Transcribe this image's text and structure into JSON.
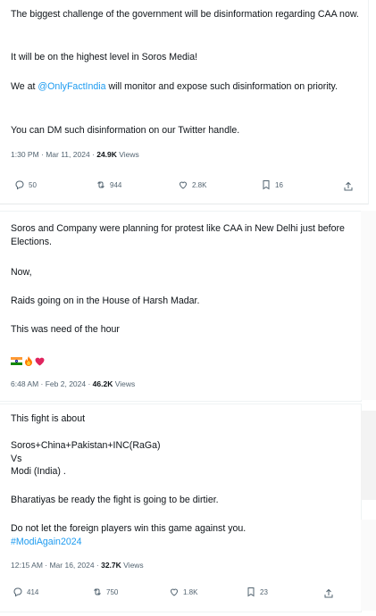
{
  "colors": {
    "link": "#1d9bf0",
    "muted": "#536471",
    "text": "#0f1419",
    "heart": "#e0245e",
    "flame": "#ff7a00"
  },
  "tweets": [
    {
      "p1": "The biggest challenge of the government will be disinformation regarding CAA now.",
      "p2": "It will be on the highest level in Soros Media!",
      "p3_pre": "We at ",
      "p3_mention": "@OnlyFactIndia",
      "p3_post": " will monitor and expose such disinformation on priority.",
      "p4": "You can DM such disinformation on our Twitter handle.",
      "time": "1:30 PM · Mar 11, 2024 · ",
      "views_count": "24.9K",
      "views_label": " Views",
      "replies": "50",
      "reposts": "944",
      "likes": "2.8K",
      "bookmarks": "16"
    },
    {
      "p1": "Soros and Company were planning for protest like CAA in New Delhi just before Elections.",
      "p2": "Now,",
      "p3": "Raids going on in the House of Harsh Madar.",
      "p4": "This was need of the hour",
      "emojis": [
        "india-flag",
        "fire",
        "red-heart"
      ],
      "time": "6:48 AM · Feb 2, 2024 · ",
      "views_count": "46.2K",
      "views_label": " Views"
    },
    {
      "p1": "This fight is about",
      "p2": "Soros+China+Pakistan+INC(RaGa)\nVs\nModi (India) .",
      "p3": "Bharatiyas be ready the fight is going to be dirtier.",
      "p4": "Do not let the foreign players win this game against you.",
      "hashtag": "#ModiAgain2024",
      "time": "12:15 AM · Mar 16, 2024 · ",
      "views_count": "32.7K",
      "views_label": " Views",
      "replies": "414",
      "reposts": "750",
      "likes": "1.8K",
      "bookmarks": "23"
    }
  ]
}
